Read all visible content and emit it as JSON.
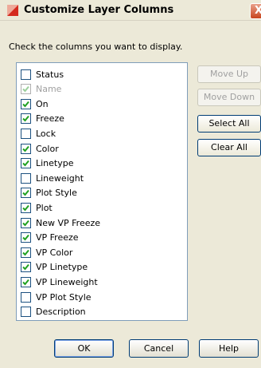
{
  "window": {
    "title": "Customize Layer Columns",
    "close_glyph": "X",
    "instruction": "Check the columns you want to display."
  },
  "columns": [
    {
      "label": "Status",
      "checked": false,
      "enabled": true
    },
    {
      "label": "Name",
      "checked": true,
      "enabled": false
    },
    {
      "label": "On",
      "checked": true,
      "enabled": true
    },
    {
      "label": "Freeze",
      "checked": true,
      "enabled": true
    },
    {
      "label": "Lock",
      "checked": false,
      "enabled": true
    },
    {
      "label": "Color",
      "checked": true,
      "enabled": true
    },
    {
      "label": "Linetype",
      "checked": true,
      "enabled": true
    },
    {
      "label": "Lineweight",
      "checked": false,
      "enabled": true
    },
    {
      "label": "Plot Style",
      "checked": true,
      "enabled": true
    },
    {
      "label": "Plot",
      "checked": true,
      "enabled": true
    },
    {
      "label": "New VP Freeze",
      "checked": true,
      "enabled": true
    },
    {
      "label": "VP Freeze",
      "checked": true,
      "enabled": true
    },
    {
      "label": "VP Color",
      "checked": true,
      "enabled": true
    },
    {
      "label": "VP Linetype",
      "checked": true,
      "enabled": true
    },
    {
      "label": "VP Lineweight",
      "checked": true,
      "enabled": true
    },
    {
      "label": "VP Plot Style",
      "checked": false,
      "enabled": true
    },
    {
      "label": "Description",
      "checked": false,
      "enabled": true
    }
  ],
  "side_buttons": {
    "move_up": {
      "label": "Move Up",
      "enabled": false
    },
    "move_down": {
      "label": "Move Down",
      "enabled": false
    },
    "select_all": {
      "label": "Select All",
      "enabled": true
    },
    "clear_all": {
      "label": "Clear All",
      "enabled": true
    }
  },
  "footer_buttons": {
    "ok": "OK",
    "cancel": "Cancel",
    "help": "Help"
  },
  "colors": {
    "check_mark": "#21a121",
    "app_icon_red": "#d42a1e"
  },
  "icons": {
    "app": "layer-icon",
    "close": "close-icon"
  }
}
